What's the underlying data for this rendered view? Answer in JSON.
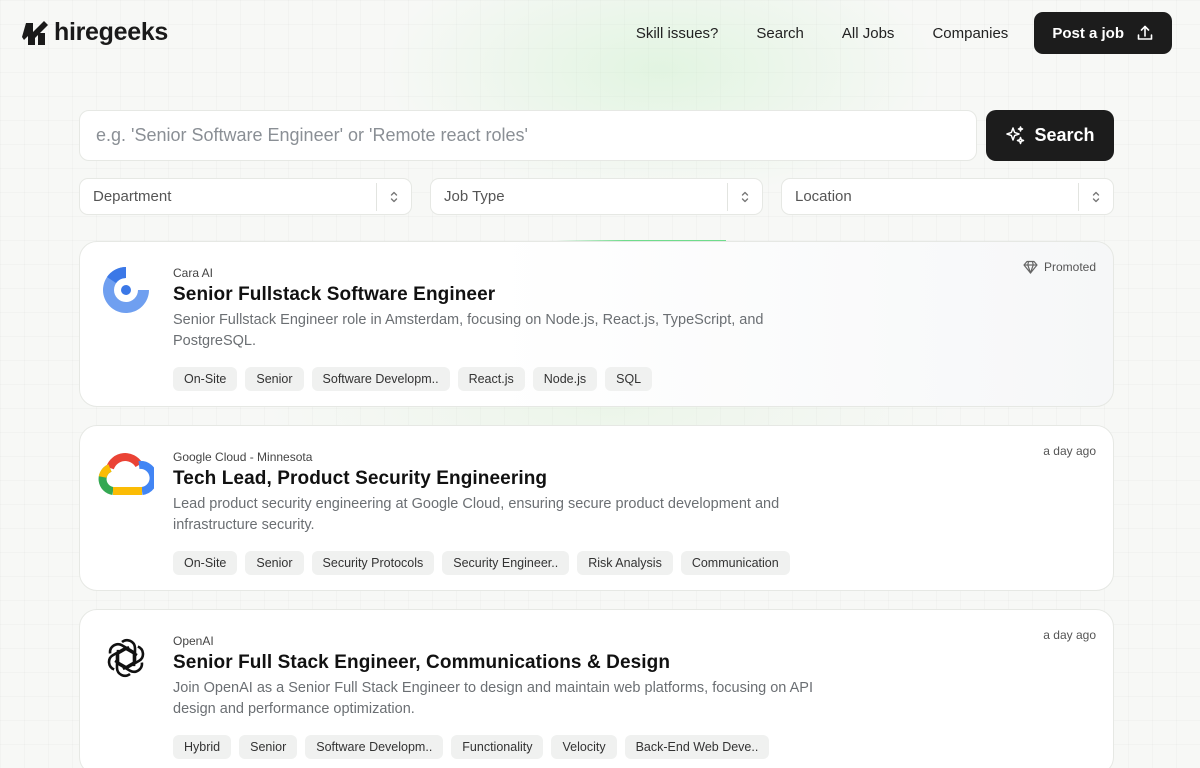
{
  "header": {
    "brand": "hiregeeks",
    "nav": [
      "Skill issues?",
      "Search",
      "All Jobs",
      "Companies"
    ],
    "post_job_label": "Post a job"
  },
  "search": {
    "placeholder": "e.g. 'Senior Software Engineer' or 'Remote react roles'",
    "button_label": "Search"
  },
  "filters": [
    {
      "label": "Department"
    },
    {
      "label": "Job Type"
    },
    {
      "label": "Location"
    }
  ],
  "jobs": [
    {
      "company": "Cara AI",
      "title": "Senior Fullstack Software Engineer",
      "description": "Senior Fullstack Engineer role in Amsterdam, focusing on Node.js, React.js, TypeScript, and PostgreSQL.",
      "meta": "Promoted",
      "logo_icon": "cara-ai-logo",
      "tags": [
        "On-Site",
        "Senior",
        "Software Developm..",
        "React.js",
        "Node.js",
        "SQL"
      ]
    },
    {
      "company": "Google Cloud - Minnesota",
      "title": "Tech Lead, Product Security Engineering",
      "description": "Lead product security engineering at Google Cloud, ensuring secure product development and infrastructure security.",
      "meta": "a day ago",
      "logo_icon": "google-cloud-logo",
      "tags": [
        "On-Site",
        "Senior",
        "Security Protocols",
        "Security Engineer..",
        "Risk Analysis",
        "Communication"
      ]
    },
    {
      "company": "OpenAI",
      "title": "Senior Full Stack Engineer, Communications & Design",
      "description": "Join OpenAI as a Senior Full Stack Engineer to design and maintain web platforms, focusing on API design and performance optimization.",
      "meta": "a day ago",
      "logo_icon": "openai-logo",
      "tags": [
        "Hybrid",
        "Senior",
        "Software Developm..",
        "Functionality",
        "Velocity",
        "Back-End Web Deve.."
      ]
    }
  ],
  "colors": {
    "accent_dark": "#1c1c1c",
    "progress_green": "#6fdc8c"
  }
}
